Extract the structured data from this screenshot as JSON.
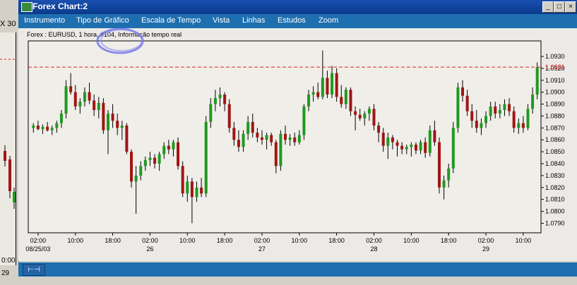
{
  "left_panel": {
    "label": "X 30",
    "times": [
      "0:00",
      "29"
    ]
  },
  "window": {
    "title": "Forex Chart:2",
    "buttons": [
      "_",
      "□",
      "×"
    ]
  },
  "menu": [
    "Instrumento",
    "Tipo de Gráfico",
    "Escala de Tempo",
    "Vista",
    "Linhas",
    "Estudos",
    "Zoom"
  ],
  "chart_header": "Forex : EURUSD, 1 hora, #104, Informação tempo real",
  "status_button_label": "⊢⊣",
  "chart_data": {
    "type": "candlestick",
    "symbol": "EURUSD",
    "interval": "1 hora",
    "ylim": [
      1.0782,
      1.0943
    ],
    "yticks": [
      "1.0790",
      "1.0800",
      "1.0810",
      "1.0820",
      "1.0830",
      "1.0840",
      "1.0850",
      "1.0860",
      "1.0870",
      "1.0880",
      "1.0890",
      "1.0900",
      "1.0910",
      "1.0920",
      "1.0930"
    ],
    "current_price": "1.0921",
    "current_price_color": "#e02020",
    "up_color": "#1f9a1f",
    "down_color": "#a01515",
    "xticks": [
      {
        "time": "02:00",
        "date": "08/25/03"
      },
      {
        "time": "10:00",
        "date": ""
      },
      {
        "time": "18:00",
        "date": ""
      },
      {
        "time": "02:00",
        "date": "26"
      },
      {
        "time": "10:00",
        "date": ""
      },
      {
        "time": "18:00",
        "date": ""
      },
      {
        "time": "02:00",
        "date": "27"
      },
      {
        "time": "10:00",
        "date": ""
      },
      {
        "time": "18:00",
        "date": ""
      },
      {
        "time": "02:00",
        "date": "28"
      },
      {
        "time": "10:00",
        "date": ""
      },
      {
        "time": "18:00",
        "date": ""
      },
      {
        "time": "02:00",
        "date": "29"
      },
      {
        "time": "10:00",
        "date": ""
      }
    ],
    "candles": [
      {
        "o": 1.087,
        "h": 1.0874,
        "l": 1.0866,
        "c": 1.0872
      },
      {
        "o": 1.0872,
        "h": 1.0876,
        "l": 1.0868,
        "c": 1.0869
      },
      {
        "o": 1.0869,
        "h": 1.0873,
        "l": 1.0865,
        "c": 1.0871
      },
      {
        "o": 1.0871,
        "h": 1.0875,
        "l": 1.0867,
        "c": 1.0868
      },
      {
        "o": 1.0868,
        "h": 1.0872,
        "l": 1.0864,
        "c": 1.087
      },
      {
        "o": 1.087,
        "h": 1.0876,
        "l": 1.0866,
        "c": 1.0874
      },
      {
        "o": 1.0874,
        "h": 1.0885,
        "l": 1.087,
        "c": 1.0882
      },
      {
        "o": 1.0882,
        "h": 1.091,
        "l": 1.0878,
        "c": 1.0905
      },
      {
        "o": 1.0905,
        "h": 1.0916,
        "l": 1.0898,
        "c": 1.09
      },
      {
        "o": 1.09,
        "h": 1.0906,
        "l": 1.0885,
        "c": 1.0888
      },
      {
        "o": 1.0888,
        "h": 1.0895,
        "l": 1.0882,
        "c": 1.0892
      },
      {
        "o": 1.0892,
        "h": 1.0904,
        "l": 1.0888,
        "c": 1.09
      },
      {
        "o": 1.09,
        "h": 1.0908,
        "l": 1.089,
        "c": 1.0893
      },
      {
        "o": 1.0893,
        "h": 1.0898,
        "l": 1.088,
        "c": 1.0885
      },
      {
        "o": 1.0885,
        "h": 1.0896,
        "l": 1.0878,
        "c": 1.0891
      },
      {
        "o": 1.0891,
        "h": 1.0895,
        "l": 1.0865,
        "c": 1.0868
      },
      {
        "o": 1.0868,
        "h": 1.0885,
        "l": 1.0848,
        "c": 1.0882
      },
      {
        "o": 1.0882,
        "h": 1.089,
        "l": 1.087,
        "c": 1.0876
      },
      {
        "o": 1.0876,
        "h": 1.0882,
        "l": 1.0864,
        "c": 1.087
      },
      {
        "o": 1.087,
        "h": 1.0876,
        "l": 1.086,
        "c": 1.0872
      },
      {
        "o": 1.0872,
        "h": 1.0874,
        "l": 1.0848,
        "c": 1.085
      },
      {
        "o": 1.085,
        "h": 1.0852,
        "l": 1.082,
        "c": 1.0825
      },
      {
        "o": 1.0825,
        "h": 1.0838,
        "l": 1.0798,
        "c": 1.083
      },
      {
        "o": 1.083,
        "h": 1.0842,
        "l": 1.0826,
        "c": 1.0838
      },
      {
        "o": 1.0838,
        "h": 1.0846,
        "l": 1.0834,
        "c": 1.0843
      },
      {
        "o": 1.0843,
        "h": 1.085,
        "l": 1.0838,
        "c": 1.0845
      },
      {
        "o": 1.0845,
        "h": 1.0848,
        "l": 1.0836,
        "c": 1.084
      },
      {
        "o": 1.084,
        "h": 1.085,
        "l": 1.0834,
        "c": 1.0848
      },
      {
        "o": 1.0848,
        "h": 1.0858,
        "l": 1.0844,
        "c": 1.0855
      },
      {
        "o": 1.0855,
        "h": 1.086,
        "l": 1.0848,
        "c": 1.0852
      },
      {
        "o": 1.0852,
        "h": 1.086,
        "l": 1.0846,
        "c": 1.0858
      },
      {
        "o": 1.0858,
        "h": 1.0862,
        "l": 1.0835,
        "c": 1.0838
      },
      {
        "o": 1.0838,
        "h": 1.0842,
        "l": 1.0812,
        "c": 1.0815
      },
      {
        "o": 1.0815,
        "h": 1.083,
        "l": 1.0808,
        "c": 1.0825
      },
      {
        "o": 1.0825,
        "h": 1.0828,
        "l": 1.079,
        "c": 1.0812
      },
      {
        "o": 1.0812,
        "h": 1.0825,
        "l": 1.0808,
        "c": 1.082
      },
      {
        "o": 1.082,
        "h": 1.0828,
        "l": 1.0812,
        "c": 1.0815
      },
      {
        "o": 1.0815,
        "h": 1.088,
        "l": 1.0812,
        "c": 1.0875
      },
      {
        "o": 1.0875,
        "h": 1.0895,
        "l": 1.087,
        "c": 1.089
      },
      {
        "o": 1.089,
        "h": 1.0902,
        "l": 1.0884,
        "c": 1.0895
      },
      {
        "o": 1.0895,
        "h": 1.0904,
        "l": 1.0888,
        "c": 1.0898
      },
      {
        "o": 1.0898,
        "h": 1.09,
        "l": 1.0884,
        "c": 1.089
      },
      {
        "o": 1.089,
        "h": 1.0894,
        "l": 1.0866,
        "c": 1.087
      },
      {
        "o": 1.087,
        "h": 1.0875,
        "l": 1.0855,
        "c": 1.086
      },
      {
        "o": 1.086,
        "h": 1.0868,
        "l": 1.085,
        "c": 1.0854
      },
      {
        "o": 1.0854,
        "h": 1.0868,
        "l": 1.085,
        "c": 1.0865
      },
      {
        "o": 1.0865,
        "h": 1.088,
        "l": 1.086,
        "c": 1.0875
      },
      {
        "o": 1.0875,
        "h": 1.0882,
        "l": 1.0862,
        "c": 1.0866
      },
      {
        "o": 1.0866,
        "h": 1.087,
        "l": 1.0858,
        "c": 1.0862
      },
      {
        "o": 1.0862,
        "h": 1.0868,
        "l": 1.0856,
        "c": 1.086
      },
      {
        "o": 1.086,
        "h": 1.0866,
        "l": 1.0852,
        "c": 1.0864
      },
      {
        "o": 1.0864,
        "h": 1.0866,
        "l": 1.0855,
        "c": 1.0858
      },
      {
        "o": 1.0858,
        "h": 1.086,
        "l": 1.0832,
        "c": 1.0838
      },
      {
        "o": 1.0838,
        "h": 1.0868,
        "l": 1.0834,
        "c": 1.0865
      },
      {
        "o": 1.0865,
        "h": 1.0872,
        "l": 1.0856,
        "c": 1.086
      },
      {
        "o": 1.086,
        "h": 1.0865,
        "l": 1.0855,
        "c": 1.0862
      },
      {
        "o": 1.0862,
        "h": 1.0866,
        "l": 1.0855,
        "c": 1.0858
      },
      {
        "o": 1.0858,
        "h": 1.0868,
        "l": 1.0856,
        "c": 1.0864
      },
      {
        "o": 1.0864,
        "h": 1.089,
        "l": 1.086,
        "c": 1.0888
      },
      {
        "o": 1.0888,
        "h": 1.0902,
        "l": 1.0884,
        "c": 1.0898
      },
      {
        "o": 1.0898,
        "h": 1.0905,
        "l": 1.0892,
        "c": 1.09
      },
      {
        "o": 1.09,
        "h": 1.0908,
        "l": 1.0894,
        "c": 1.0896
      },
      {
        "o": 1.0896,
        "h": 1.0935,
        "l": 1.0894,
        "c": 1.0912
      },
      {
        "o": 1.0912,
        "h": 1.0918,
        "l": 1.0895,
        "c": 1.0898
      },
      {
        "o": 1.0898,
        "h": 1.0922,
        "l": 1.0895,
        "c": 1.0916
      },
      {
        "o": 1.0916,
        "h": 1.092,
        "l": 1.0892,
        "c": 1.0896
      },
      {
        "o": 1.0896,
        "h": 1.0906,
        "l": 1.0887,
        "c": 1.089
      },
      {
        "o": 1.089,
        "h": 1.0904,
        "l": 1.0886,
        "c": 1.0902
      },
      {
        "o": 1.0902,
        "h": 1.0904,
        "l": 1.088,
        "c": 1.0884
      },
      {
        "o": 1.0884,
        "h": 1.0888,
        "l": 1.0868,
        "c": 1.0881
      },
      {
        "o": 1.0881,
        "h": 1.0886,
        "l": 1.0876,
        "c": 1.0878
      },
      {
        "o": 1.0878,
        "h": 1.0884,
        "l": 1.0872,
        "c": 1.0882
      },
      {
        "o": 1.0882,
        "h": 1.0888,
        "l": 1.0876,
        "c": 1.0886
      },
      {
        "o": 1.0886,
        "h": 1.089,
        "l": 1.0868,
        "c": 1.0872
      },
      {
        "o": 1.0872,
        "h": 1.0875,
        "l": 1.0858,
        "c": 1.0866
      },
      {
        "o": 1.0866,
        "h": 1.087,
        "l": 1.085,
        "c": 1.0855
      },
      {
        "o": 1.0855,
        "h": 1.0866,
        "l": 1.0844,
        "c": 1.0862
      },
      {
        "o": 1.0862,
        "h": 1.0864,
        "l": 1.0852,
        "c": 1.0858
      },
      {
        "o": 1.0858,
        "h": 1.086,
        "l": 1.0846,
        "c": 1.0855
      },
      {
        "o": 1.0855,
        "h": 1.0858,
        "l": 1.0848,
        "c": 1.0852
      },
      {
        "o": 1.0852,
        "h": 1.0856,
        "l": 1.0848,
        "c": 1.0854
      },
      {
        "o": 1.0854,
        "h": 1.0858,
        "l": 1.0846,
        "c": 1.0856
      },
      {
        "o": 1.0856,
        "h": 1.0858,
        "l": 1.0848,
        "c": 1.0851
      },
      {
        "o": 1.0851,
        "h": 1.086,
        "l": 1.0848,
        "c": 1.0858
      },
      {
        "o": 1.0858,
        "h": 1.0862,
        "l": 1.0845,
        "c": 1.0849
      },
      {
        "o": 1.0849,
        "h": 1.0872,
        "l": 1.0846,
        "c": 1.0868
      },
      {
        "o": 1.0868,
        "h": 1.0876,
        "l": 1.0855,
        "c": 1.0858
      },
      {
        "o": 1.0858,
        "h": 1.0862,
        "l": 1.0815,
        "c": 1.082
      },
      {
        "o": 1.082,
        "h": 1.083,
        "l": 1.081,
        "c": 1.0826
      },
      {
        "o": 1.0826,
        "h": 1.084,
        "l": 1.082,
        "c": 1.0836
      },
      {
        "o": 1.0836,
        "h": 1.0875,
        "l": 1.0832,
        "c": 1.087
      },
      {
        "o": 1.087,
        "h": 1.0908,
        "l": 1.0866,
        "c": 1.0904
      },
      {
        "o": 1.0904,
        "h": 1.091,
        "l": 1.0892,
        "c": 1.0897
      },
      {
        "o": 1.0897,
        "h": 1.0902,
        "l": 1.088,
        "c": 1.0884
      },
      {
        "o": 1.0884,
        "h": 1.089,
        "l": 1.087,
        "c": 1.0876
      },
      {
        "o": 1.0876,
        "h": 1.0885,
        "l": 1.0866,
        "c": 1.087
      },
      {
        "o": 1.087,
        "h": 1.0878,
        "l": 1.0864,
        "c": 1.0874
      },
      {
        "o": 1.0874,
        "h": 1.0884,
        "l": 1.087,
        "c": 1.088
      },
      {
        "o": 1.088,
        "h": 1.0892,
        "l": 1.0876,
        "c": 1.0888
      },
      {
        "o": 1.0888,
        "h": 1.0892,
        "l": 1.0878,
        "c": 1.0882
      },
      {
        "o": 1.0882,
        "h": 1.089,
        "l": 1.0878,
        "c": 1.0885
      },
      {
        "o": 1.0885,
        "h": 1.0894,
        "l": 1.088,
        "c": 1.089
      },
      {
        "o": 1.089,
        "h": 1.0895,
        "l": 1.088,
        "c": 1.0884
      },
      {
        "o": 1.0884,
        "h": 1.0888,
        "l": 1.0866,
        "c": 1.087
      },
      {
        "o": 1.087,
        "h": 1.0878,
        "l": 1.0865,
        "c": 1.0874
      },
      {
        "o": 1.0874,
        "h": 1.088,
        "l": 1.0866,
        "c": 1.087
      },
      {
        "o": 1.087,
        "h": 1.089,
        "l": 1.0868,
        "c": 1.0886
      },
      {
        "o": 1.0886,
        "h": 1.0904,
        "l": 1.0882,
        "c": 1.0898
      },
      {
        "o": 1.0898,
        "h": 1.0925,
        "l": 1.0894,
        "c": 1.0921
      }
    ]
  }
}
